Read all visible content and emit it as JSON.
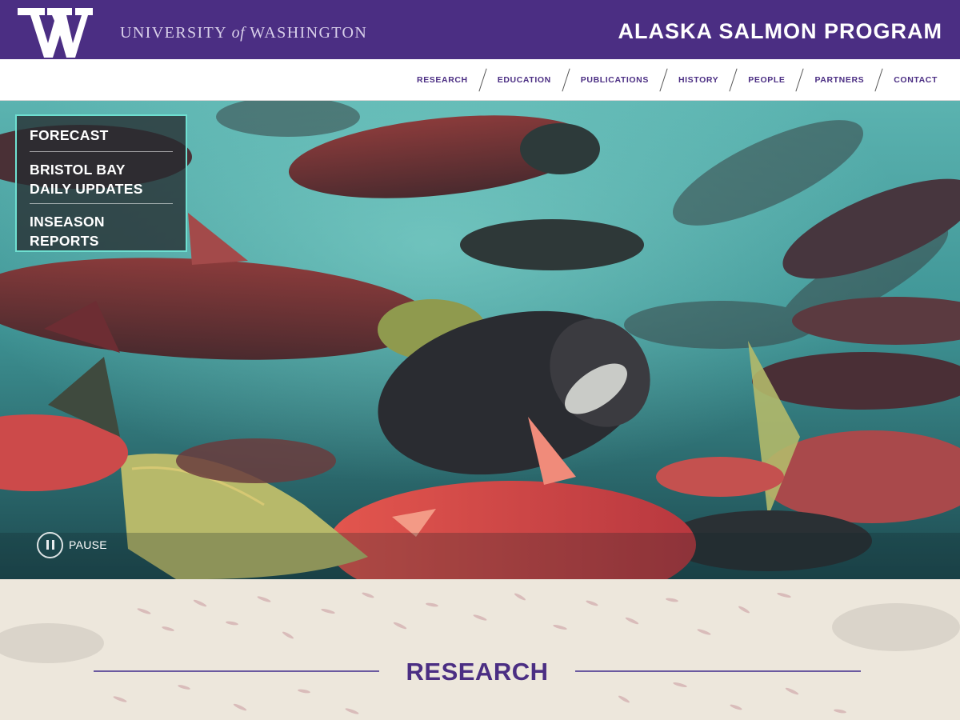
{
  "header": {
    "logo_letter": "W",
    "university": {
      "prefix": "UNIVERSITY",
      "of": "of",
      "suffix": "WASHINGTON"
    },
    "site_title": "ALASKA SALMON PROGRAM"
  },
  "nav": {
    "items": [
      {
        "label": "RESEARCH"
      },
      {
        "label": "EDUCATION"
      },
      {
        "label": "PUBLICATIONS"
      },
      {
        "label": "HISTORY"
      },
      {
        "label": "PEOPLE"
      },
      {
        "label": "PARTNERS"
      },
      {
        "label": "CONTACT"
      }
    ]
  },
  "hero": {
    "quick_links": [
      {
        "label": "FORECAST"
      },
      {
        "label": "BRISTOL BAY\nDAILY UPDATES"
      },
      {
        "label": "INSEASON REPORTS"
      }
    ],
    "pause_label": "PAUSE"
  },
  "research": {
    "heading": "RESEARCH"
  },
  "colors": {
    "uw_purple": "#4b2e83",
    "accent_teal": "#6fe0d1",
    "water": "#3c8f8f"
  },
  "icons": {
    "uw_logo": "uw-w-logo",
    "pause": "pause-icon"
  }
}
